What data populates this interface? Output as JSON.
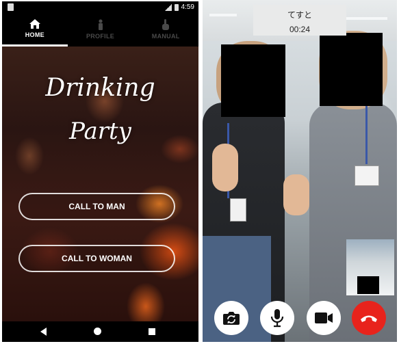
{
  "left_screen": {
    "status_bar": {
      "time": "4:59"
    },
    "tabs": [
      {
        "label": "HOME",
        "icon": "house-icon",
        "active": true
      },
      {
        "label": "PROFILE",
        "icon": "person-icon",
        "active": false
      },
      {
        "label": "MANUAL",
        "icon": "hand-pointer-icon",
        "active": false
      }
    ],
    "title_line1": "Drinking",
    "title_line2": "Party",
    "buttons": {
      "call_to_man": "CALL TO MAN",
      "call_to_woman": "CALL TO WOMAN"
    },
    "system_nav": [
      "back-icon",
      "home-icon",
      "recents-icon"
    ]
  },
  "right_screen": {
    "caller_name": "てすと",
    "call_timer": "00:24",
    "controls": [
      {
        "name": "switch-camera",
        "icon": "camera-switch-icon",
        "color": "#ffffff"
      },
      {
        "name": "mute",
        "icon": "microphone-icon",
        "color": "#ffffff"
      },
      {
        "name": "video",
        "icon": "video-camera-icon",
        "color": "#ffffff"
      },
      {
        "name": "end-call",
        "icon": "phone-hangup-icon",
        "color": "#e8231c"
      }
    ]
  }
}
